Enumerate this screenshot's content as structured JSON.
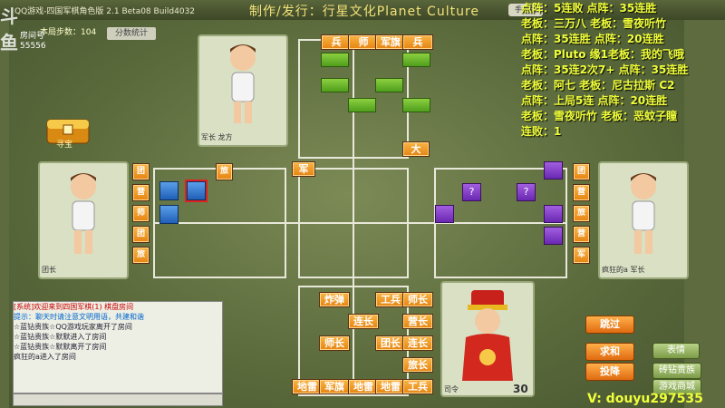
{
  "window": {
    "title": "QQ游戏-四国军棋角色版 2.1 Beta08 Build4032",
    "producer": "制作/发行：行星文化Planet Culture",
    "handheld_button": "手机版",
    "stats_button": "分数统计",
    "steps_label": "本局步数：104",
    "room_label": "房间号",
    "room_number": "55556",
    "treasure_label": "寻宝"
  },
  "players": {
    "top": {
      "name": "龙方",
      "rank": "军长"
    },
    "left": {
      "name": "",
      "rank": "团长"
    },
    "right": {
      "name": "疯狂的a",
      "rank": "军长"
    },
    "bottom": {
      "name": "",
      "rank": "司令",
      "timer": "30"
    }
  },
  "overlay_text": [
    "点阵：5连败      点阵：35连胜",
    "老板：三万八      老板：雪夜听竹",
    "点阵：35连胜     点阵：20连胜",
    "老板：Pluto 缘1老板：我的飞哦",
    "点阵：35连2次7+ 点阵：35连胜",
    "老板：阿七        老板：尼古拉斯 C2",
    "点阵：上局5连    点阵：20连胜",
    "老板：雪夜听竹    老板：恶蚊子瞳",
    "连败：1"
  ],
  "top_pieces": [
    "兵",
    "师",
    "军旗",
    "兵"
  ],
  "top_piece_da": "大",
  "top_piece_jun": "军",
  "left_pieces": [
    "团",
    "营",
    "师",
    "团",
    "旅"
  ],
  "left_piece_lv": "旅",
  "right_pieces": [
    "团",
    "营",
    "旅",
    "营",
    "军"
  ],
  "purple_marks": [
    "?",
    "?"
  ],
  "bottom_pieces": {
    "row1": [
      "炸弹",
      "工兵",
      "师长"
    ],
    "row2": [
      "连长",
      "营长"
    ],
    "row3": [
      "师长",
      "团长",
      "连长"
    ],
    "row4": [
      "旅长"
    ],
    "row5": [
      "地雷",
      "军旗",
      "地雷",
      "地雷",
      "工兵"
    ]
  },
  "buttons": {
    "skip": "跳过",
    "peace": "求和",
    "surrender": "投降",
    "emote": "表情",
    "diamond": "砖钻贵族",
    "mall": "游戏商城"
  },
  "chat": {
    "lines": [
      "[系统]欢迎来到四国军棋(1) 棋盘房间",
      "提示：聊天时请注意文明用语，共建和谐",
      "☆蓝钻贵族☆QQ游戏玩家离开了房间",
      "☆蓝钻贵族☆默默进入了房间",
      "☆蓝钻贵族☆默默离开了房间",
      "疯狂的a进入了房间"
    ]
  },
  "watermark": "V: douyu297535",
  "logo": "斗鱼"
}
